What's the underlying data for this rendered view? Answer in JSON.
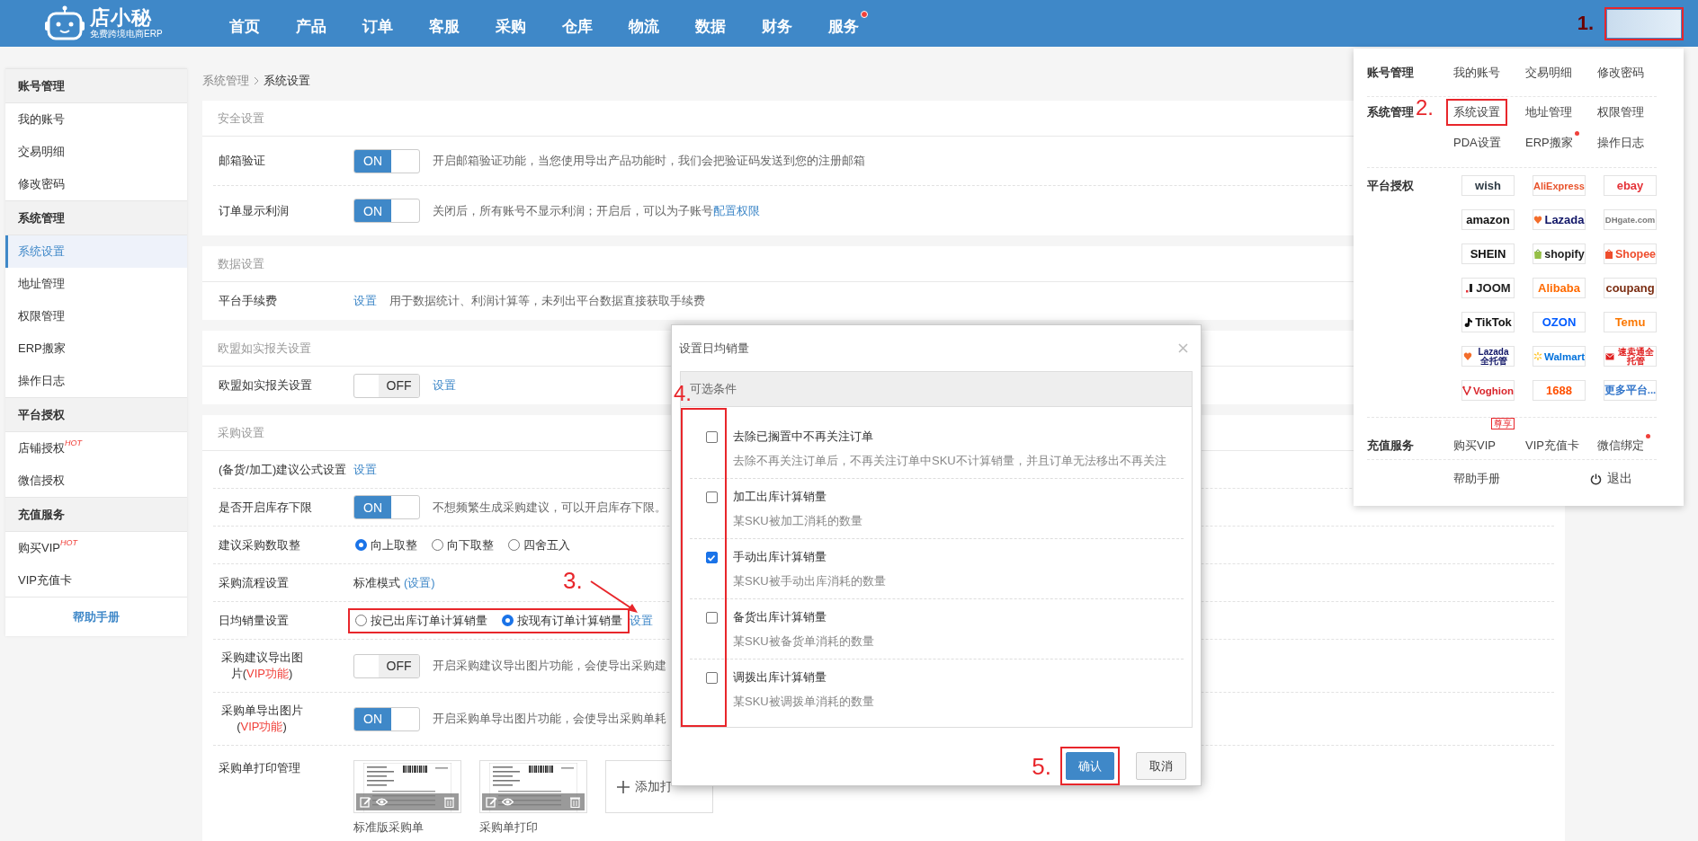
{
  "header": {
    "logo": {
      "name": "店小秘",
      "tagline": "免费跨境电商ERP"
    },
    "nav": [
      {
        "label": "首页",
        "dot": false
      },
      {
        "label": "产品",
        "dot": false
      },
      {
        "label": "订单",
        "dot": false
      },
      {
        "label": "客服",
        "dot": false
      },
      {
        "label": "采购",
        "dot": false
      },
      {
        "label": "仓库",
        "dot": false
      },
      {
        "label": "物流",
        "dot": false
      },
      {
        "label": "数据",
        "dot": false
      },
      {
        "label": "财务",
        "dot": false
      },
      {
        "label": "服务",
        "dot": true
      }
    ],
    "account_button": {
      "highlighted": true,
      "annotation": "1."
    }
  },
  "sidebar": {
    "groups": [
      {
        "title": "账号管理",
        "items": [
          {
            "label": "我的账号",
            "selected": false
          },
          {
            "label": "交易明细",
            "selected": false
          },
          {
            "label": "修改密码",
            "selected": false
          }
        ]
      },
      {
        "title": "系统管理",
        "items": [
          {
            "label": "系统设置",
            "selected": true
          },
          {
            "label": "地址管理",
            "selected": false
          },
          {
            "label": "权限管理",
            "selected": false
          },
          {
            "label": "ERP搬家",
            "selected": false
          },
          {
            "label": "操作日志",
            "selected": false
          }
        ]
      },
      {
        "title": "平台授权",
        "items": [
          {
            "label": "店铺授权",
            "selected": false,
            "badge": "HOT"
          },
          {
            "label": "微信授权",
            "selected": false
          }
        ]
      },
      {
        "title": "充值服务",
        "items": [
          {
            "label": "购买VIP",
            "selected": false,
            "badge": "HOT"
          },
          {
            "label": "VIP充值卡",
            "selected": false
          }
        ]
      }
    ],
    "help": "帮助手册"
  },
  "breadcrumb": [
    "系统管理",
    "系统设置"
  ],
  "sections": [
    {
      "title": "安全设置",
      "kind": "tall",
      "rows": [
        {
          "kind": "switch",
          "label": "邮箱验证",
          "on": true,
          "state_label": "ON",
          "text": "开启邮箱验证功能，当您使用导出产品功能时，我们会把验证码发送到您的注册邮箱"
        },
        {
          "kind": "switch",
          "label": "订单显示利润",
          "on": true,
          "state_label": "ON",
          "text": "关闭后，所有账号不显示利润；开启后，可以为子账号",
          "link": "配置权限"
        }
      ]
    },
    {
      "title": "数据设置",
      "kind": "normal",
      "rows": [
        {
          "kind": "link",
          "label": "平台手续费",
          "link": "设置",
          "text": "用于数据统计、利润计算等，未列出平台数据直接获取手续费"
        }
      ]
    },
    {
      "title": "欧盟如实报关设置",
      "kind": "normal",
      "rows": [
        {
          "kind": "switch",
          "label": "欧盟如实报关设置",
          "on": false,
          "state_label": "OFF",
          "link": "设置"
        }
      ]
    },
    {
      "title": "采购设置",
      "kind": "normal",
      "rows": [
        {
          "kind": "link",
          "label": "(备货/加工)建议公式设置",
          "link": "设置"
        },
        {
          "kind": "switch",
          "label": "是否开启库存下限",
          "on": true,
          "state_label": "ON",
          "text": "不想频繁生成采购建议，可以开启库存下限。"
        },
        {
          "kind": "radios",
          "label": "建议采购数取整",
          "highlighted": false,
          "options": [
            {
              "label": "向上取整",
              "selected": true
            },
            {
              "label": "向下取整",
              "selected": false
            },
            {
              "label": "四舍五入",
              "selected": false
            }
          ]
        },
        {
          "kind": "mode",
          "label": "采购流程设置",
          "value": "标准模式",
          "link": "(设置)"
        },
        {
          "kind": "radios",
          "label": "日均销量设置",
          "highlighted": true,
          "options": [
            {
              "label": "按已出库订单计算销量",
              "selected": false
            },
            {
              "label": "按现有订单计算销量",
              "selected": true
            }
          ],
          "link": "设置",
          "annotation": "3."
        },
        {
          "kind": "switch",
          "label": "采购建议导出图片(",
          "vip": "VIP功能",
          "label_end": ")",
          "on": false,
          "state_label": "OFF",
          "text": "开启采购建议导出图片功能，会使导出采购建"
        },
        {
          "kind": "switch",
          "label": "采购单导出图片(",
          "vip": "VIP功能",
          "label_end": ")",
          "on": true,
          "state_label": "ON",
          "text": "开启采购单导出图片功能，会使导出采购单耗"
        },
        {
          "kind": "templates",
          "label": "采购单打印管理",
          "templates": [
            {
              "caption": "标准版采购单"
            },
            {
              "caption": "采购单打印"
            }
          ],
          "add": "添加打"
        }
      ]
    }
  ],
  "dialog": {
    "title": "设置日均销量",
    "header": "可选条件",
    "highlighted": true,
    "annotation": "4.",
    "options": [
      {
        "title": "去除已搁置中不再关注订单",
        "desc": "去除不再关注订单后，不再关注订单中SKU不计算销量，并且订单无法移出不再关注",
        "checked": false
      },
      {
        "title": "加工出库计算销量",
        "desc": "某SKU被加工消耗的数量",
        "checked": false
      },
      {
        "title": "手动出库计算销量",
        "desc": "某SKU被手动出库消耗的数量",
        "checked": true
      },
      {
        "title": "备货出库计算销量",
        "desc": "某SKU被备货单消耗的数量",
        "checked": false
      },
      {
        "title": "调拨出库计算销量",
        "desc": "某SKU被调拨单消耗的数量",
        "checked": false
      }
    ],
    "buttons": [
      {
        "label": "确认",
        "kind": "primary",
        "highlighted": true,
        "annotation": "5."
      },
      {
        "label": "取消",
        "kind": "default",
        "highlighted": false
      }
    ]
  },
  "account_menu": {
    "groups": [
      {
        "title": "账号管理",
        "kind": "links",
        "items": [
          {
            "label": "我的账号",
            "dot": false,
            "highlighted": false
          },
          {
            "label": "交易明细",
            "dot": false,
            "highlighted": false
          },
          {
            "label": "修改密码",
            "dot": false,
            "highlighted": false
          }
        ]
      },
      {
        "title": "系统管理",
        "kind": "links",
        "items": [
          {
            "label": "系统设置",
            "dot": false,
            "highlighted": true,
            "annotation": "2."
          },
          {
            "label": "地址管理",
            "dot": false,
            "highlighted": false
          },
          {
            "label": "权限管理",
            "dot": false,
            "highlighted": false
          },
          {
            "label": "PDA设置",
            "dot": false,
            "highlighted": false
          },
          {
            "label": "ERP搬家",
            "dot": true,
            "highlighted": false
          },
          {
            "label": "操作日志",
            "dot": false,
            "highlighted": false
          }
        ]
      },
      {
        "title": "平台授权",
        "kind": "platforms",
        "platforms": [
          {
            "label": "wish",
            "color": "#2f3b45",
            "kind": "text"
          },
          {
            "label": "AliExpress",
            "color": "#e8532b",
            "kind": "text"
          },
          {
            "label": "ebay",
            "color": "#e53238",
            "kind": "text"
          },
          {
            "label": "amazon",
            "color": "#111111",
            "kind": "text"
          },
          {
            "label": "Lazada",
            "color": "#101566",
            "kind": "heart"
          },
          {
            "label": "DHgate.com",
            "color": "#7a7a7a",
            "kind": "text"
          },
          {
            "label": "SHEIN",
            "color": "#111111",
            "kind": "text"
          },
          {
            "label": "shopify",
            "color": "#1c1c1c",
            "kind": "leafbag"
          },
          {
            "label": "Shopee",
            "color": "#ee4d2d",
            "kind": "bag"
          },
          {
            "label": "JOOM",
            "color": "#222222",
            "kind": "bar"
          },
          {
            "label": "Alibaba",
            "color": "#ff6a00",
            "kind": "text"
          },
          {
            "label": "coupang",
            "color": "#7b2d12",
            "kind": "text"
          },
          {
            "label": "TikTok",
            "color": "#111111",
            "kind": "note"
          },
          {
            "label": "OZON",
            "color": "#005bff",
            "kind": "text"
          },
          {
            "label": "Temu",
            "color": "#fb7701",
            "kind": "text"
          },
          {
            "label": "Lazada全托管",
            "color": "#101566",
            "kind": "heart"
          },
          {
            "label": "Walmart",
            "color": "#0071dc",
            "kind": "spark"
          },
          {
            "label": "速卖通全托管",
            "color": "#e02020",
            "kind": "envelope"
          },
          {
            "label": "Voghion",
            "color": "#d9262c",
            "kind": "vee"
          },
          {
            "label": "1688",
            "color": "#ff5000",
            "kind": "text"
          },
          {
            "label": "更多平台...",
            "color": "#2f73c9",
            "kind": "text"
          }
        ]
      },
      {
        "title": "充值服务",
        "kind": "links",
        "items": [
          {
            "label": "购买VIP",
            "dot": false,
            "highlighted": false,
            "badge": "尊享"
          },
          {
            "label": "VIP充值卡",
            "dot": false,
            "highlighted": false
          },
          {
            "label": "微信绑定",
            "dot": true,
            "highlighted": false
          }
        ]
      }
    ],
    "help": "帮助手册",
    "logout": "退出"
  }
}
